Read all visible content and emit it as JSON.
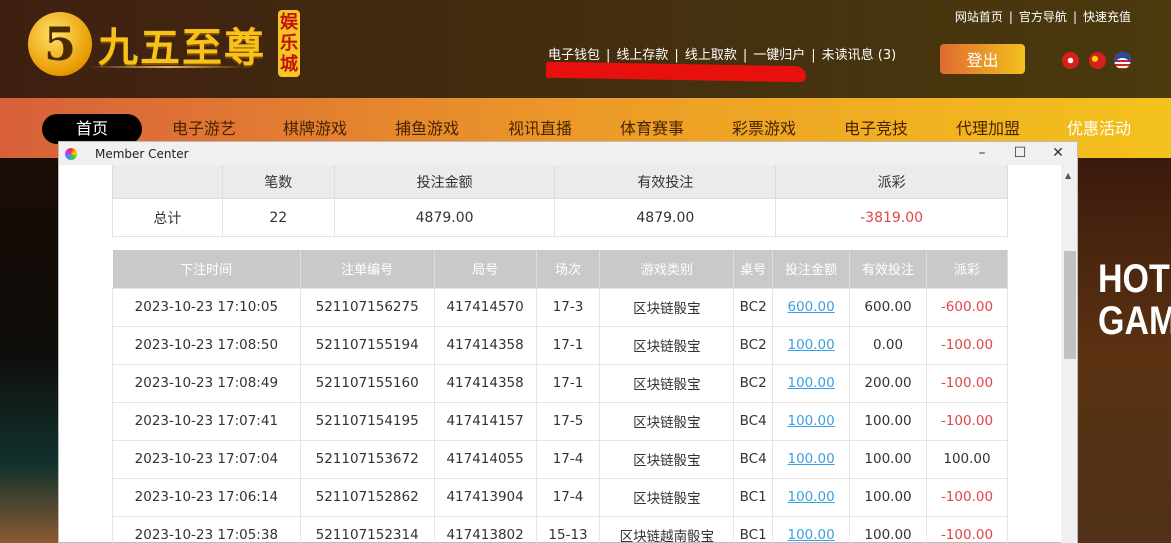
{
  "header": {
    "logo_mark": "5",
    "logo_text": "九五至尊",
    "logo_tag": "娱乐城",
    "top_links": [
      "网站首页",
      "官方导航",
      "快速充值"
    ],
    "user_links": [
      "电子钱包",
      "线上存款",
      "线上取款",
      "一键归户",
      "未读讯息 (3)"
    ],
    "logout": "登出",
    "flags": [
      "hong-kong",
      "china",
      "usa"
    ]
  },
  "nav": [
    "首页",
    "电子游艺",
    "棋牌游戏",
    "捕鱼游戏",
    "视讯直播",
    "体育赛事",
    "彩票游戏",
    "电子竞技",
    "代理加盟",
    "优惠活动"
  ],
  "banner_text": [
    "HOT",
    "GAM"
  ],
  "window": {
    "title": "Member Center",
    "min": "–",
    "max": "☐",
    "close": "✕"
  },
  "summary": {
    "headers": [
      "",
      "笔数",
      "投注金额",
      "有效投注",
      "派彩"
    ],
    "row": [
      "总计",
      "22",
      "4879.00",
      "4879.00",
      "-3819.00"
    ]
  },
  "bets": {
    "headers": [
      "下注时间",
      "注单编号",
      "局号",
      "场次",
      "游戏类别",
      "桌号",
      "投注金额",
      "有效投注",
      "派彩"
    ],
    "rows": [
      [
        "2023-10-23 17:10:05",
        "521107156275",
        "417414570",
        "17-3",
        "区块链骰宝",
        "BC2",
        "600.00",
        "600.00",
        "-600.00"
      ],
      [
        "2023-10-23 17:08:50",
        "521107155194",
        "417414358",
        "17-1",
        "区块链骰宝",
        "BC2",
        "100.00",
        "0.00",
        "-100.00"
      ],
      [
        "2023-10-23 17:08:49",
        "521107155160",
        "417414358",
        "17-1",
        "区块链骰宝",
        "BC2",
        "100.00",
        "200.00",
        "-100.00"
      ],
      [
        "2023-10-23 17:07:41",
        "521107154195",
        "417414157",
        "17-5",
        "区块链骰宝",
        "BC4",
        "100.00",
        "100.00",
        "-100.00"
      ],
      [
        "2023-10-23 17:07:04",
        "521107153672",
        "417414055",
        "17-4",
        "区块链骰宝",
        "BC4",
        "100.00",
        "100.00",
        "100.00"
      ],
      [
        "2023-10-23 17:06:14",
        "521107152862",
        "417413904",
        "17-4",
        "区块链骰宝",
        "BC1",
        "100.00",
        "100.00",
        "-100.00"
      ],
      [
        "2023-10-23 17:05:38",
        "521107152314",
        "417413802",
        "15-13",
        "区块链越南骰宝",
        "BC1",
        "100.00",
        "100.00",
        "-100.00"
      ]
    ]
  }
}
